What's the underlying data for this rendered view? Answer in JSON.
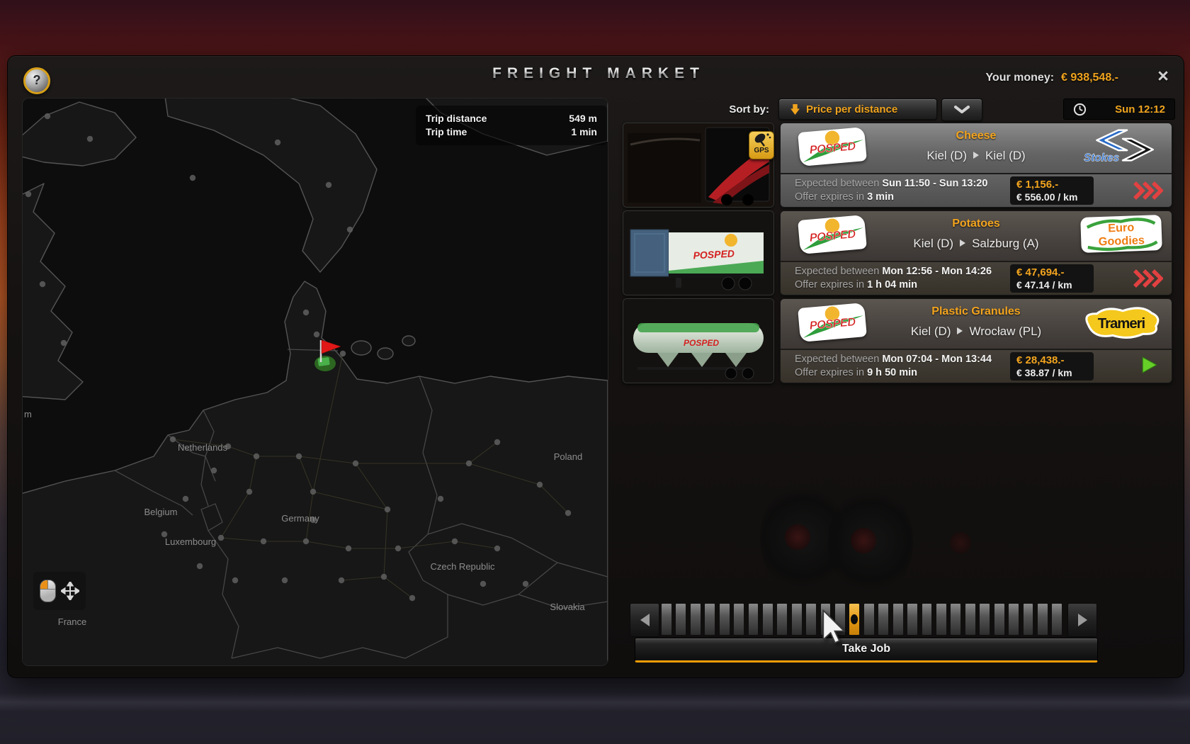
{
  "window": {
    "title": "FREIGHT MARKET",
    "money_label": "Your money:",
    "money_value": "€ 938,548.-",
    "help_glyph": "?",
    "close_glyph": "×"
  },
  "toolbar": {
    "sort_label": "Sort by:",
    "sort_value": "Price per distance",
    "clock_time": "Sun 12:12"
  },
  "map": {
    "trip_distance_label": "Trip distance",
    "trip_distance_value": "549 m",
    "trip_time_label": "Trip time",
    "trip_time_value": "1 min",
    "labels": [
      {
        "text": "m"
      },
      {
        "text": "Netherlands"
      },
      {
        "text": "Belgium"
      },
      {
        "text": "Luxembourg"
      },
      {
        "text": "Germany"
      },
      {
        "text": "Poland"
      },
      {
        "text": "Czech Republic"
      },
      {
        "text": "Slovakia"
      },
      {
        "text": "France"
      }
    ]
  },
  "jobs": [
    {
      "selected": true,
      "carrier_logo": "POSPED",
      "gps_label": "GPS",
      "cargo": "Cheese",
      "origin": "Kiel (D)",
      "destination": "Kiel (D)",
      "recipient_logo": "Stokes",
      "expected_label": "Expected between",
      "expected_value": "Sun 11:50 - Sun 13:20",
      "expires_label": "Offer expires in",
      "expires_value": "3 min",
      "price": "€ 1,156.-",
      "price_per_km": "€ 556.00 / km",
      "urgency_icon": "red-triple-chevron"
    },
    {
      "selected": false,
      "carrier_logo": "POSPED",
      "cargo": "Potatoes",
      "origin": "Kiel (D)",
      "destination": "Salzburg (A)",
      "recipient_logo": "Euro",
      "recipient_logo_line2": "Goodies",
      "expected_label": "Expected between",
      "expected_value": "Mon 12:56 - Mon 14:26",
      "expires_label": "Offer expires in",
      "expires_value": "1 h 04 min",
      "price": "€ 47,694.-",
      "price_per_km": "€ 47.14 / km",
      "urgency_icon": "red-triple-chevron"
    },
    {
      "selected": false,
      "carrier_logo": "POSPED",
      "cargo": "Plastic Granules",
      "origin": "Kiel (D)",
      "destination": "Wrocław (PL)",
      "recipient_logo": "Trameri",
      "expected_label": "Expected between",
      "expected_value": "Mon 07:04 - Mon 13:44",
      "expires_label": "Offer expires in",
      "expires_value": "9 h 50 min",
      "price": "€ 28,438.-",
      "price_per_km": "€ 38.87 / km",
      "urgency_icon": "green-play"
    }
  ],
  "scrollbar": {
    "segments": 28,
    "active_index": 13
  },
  "footer": {
    "take_job_label": "Take Job"
  },
  "colors": {
    "accent_orange": "#f0a41e",
    "urgent_red": "#e24141",
    "ready_green": "#66cf28",
    "money_orange": "#f0a41e"
  }
}
